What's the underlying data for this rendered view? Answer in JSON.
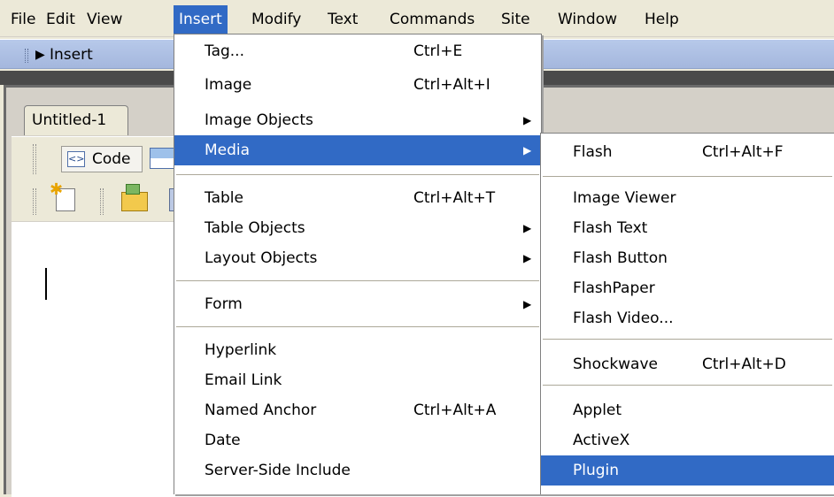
{
  "menubar": {
    "items": [
      "File",
      "Edit",
      "View",
      "Insert",
      "Modify",
      "Text",
      "Commands",
      "Site",
      "Window",
      "Help"
    ],
    "active": "Insert"
  },
  "insert_toolbar": {
    "label": "Insert",
    "arrow_icon": "triangle-right-icon"
  },
  "document": {
    "tab": "Untitled-1",
    "code_button": "Code",
    "icons": [
      "code-view-icon",
      "split-view-icon",
      "new-document-icon",
      "open-folder-icon"
    ]
  },
  "insert_menu": {
    "items": [
      {
        "label": "Tag...",
        "shortcut": "Ctrl+E",
        "submenu": false
      },
      {
        "label": "Image",
        "shortcut": "Ctrl+Alt+I",
        "submenu": false
      },
      {
        "label": "Image Objects",
        "shortcut": "",
        "submenu": true
      },
      {
        "label": "Media",
        "shortcut": "",
        "submenu": true,
        "highlighted": true
      },
      {
        "label": "Table",
        "shortcut": "Ctrl+Alt+T",
        "submenu": false
      },
      {
        "label": "Table Objects",
        "shortcut": "",
        "submenu": true
      },
      {
        "label": "Layout Objects",
        "shortcut": "",
        "submenu": true
      },
      {
        "label": "Form",
        "shortcut": "",
        "submenu": true
      },
      {
        "label": "Hyperlink",
        "shortcut": "",
        "submenu": false
      },
      {
        "label": "Email Link",
        "shortcut": "",
        "submenu": false
      },
      {
        "label": "Named Anchor",
        "shortcut": "Ctrl+Alt+A",
        "submenu": false
      },
      {
        "label": "Date",
        "shortcut": "",
        "submenu": false
      },
      {
        "label": "Server-Side Include",
        "shortcut": "",
        "submenu": false
      }
    ]
  },
  "media_menu": {
    "items": [
      {
        "label": "Flash",
        "shortcut": "Ctrl+Alt+F"
      },
      {
        "label": "Image Viewer",
        "shortcut": ""
      },
      {
        "label": "Flash Text",
        "shortcut": ""
      },
      {
        "label": "Flash Button",
        "shortcut": ""
      },
      {
        "label": "FlashPaper",
        "shortcut": ""
      },
      {
        "label": "Flash Video...",
        "shortcut": ""
      },
      {
        "label": "Shockwave",
        "shortcut": "Ctrl+Alt+D"
      },
      {
        "label": "Applet",
        "shortcut": ""
      },
      {
        "label": "ActiveX",
        "shortcut": ""
      },
      {
        "label": "Plugin",
        "shortcut": "",
        "highlighted": true
      }
    ]
  },
  "colors": {
    "highlight": "#316ac5",
    "menubar_bg": "#ece9d8",
    "toolbar_bg": "#a4b7dd"
  }
}
